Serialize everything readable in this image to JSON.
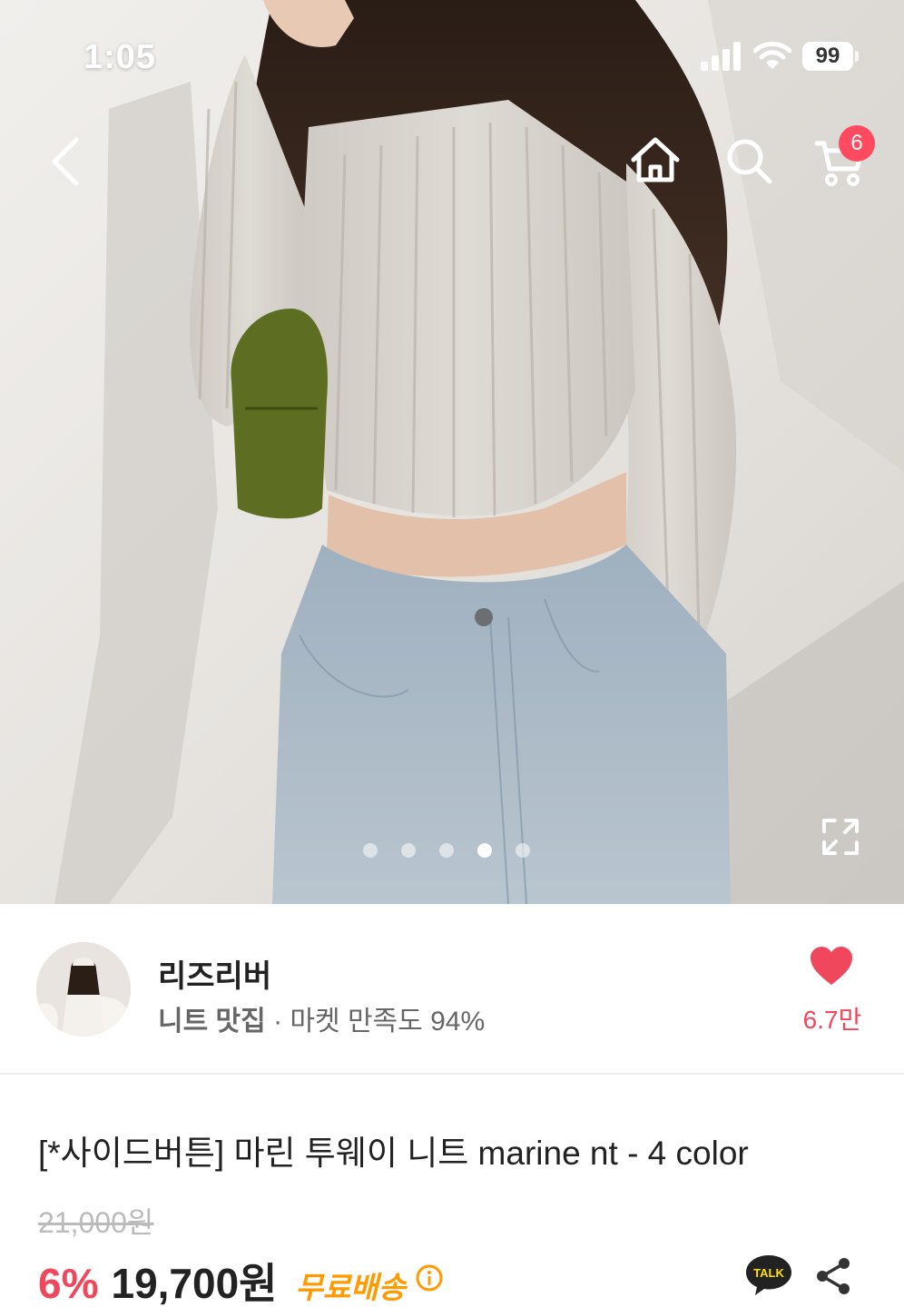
{
  "status_bar": {
    "time": "1:05",
    "battery": "99",
    "signal_icon": "signal-icon",
    "wifi_icon": "wifi-icon"
  },
  "nav": {
    "back_icon": "chevron-left-icon",
    "home_icon": "home-icon",
    "search_icon": "search-icon",
    "cart_icon": "cart-icon",
    "cart_count": "6"
  },
  "gallery": {
    "image_count": 5,
    "active_index": 3,
    "expand_icon": "expand-icon"
  },
  "shop": {
    "name": "리즈리버",
    "tag": "니트 맛집",
    "meta": " · 마켓 만족도 94%",
    "like_count": "6.7만",
    "heart_icon": "heart-icon"
  },
  "product": {
    "title": "[*사이드버튼] 마린 투웨이 니트 marine nt - 4 color",
    "original_price": "21,000원",
    "discount": "6%",
    "price": "19,700원",
    "free_shipping": "무료배송",
    "info_icon": "info-icon",
    "talk_icon": "kakao-talk-icon",
    "talk_label": "TALK",
    "share_icon": "share-icon"
  },
  "colors": {
    "accent": "#f0475c",
    "badge": "#ff4a5f",
    "free_shipping": "#ff9a00",
    "kakao_talk": "#222222"
  }
}
